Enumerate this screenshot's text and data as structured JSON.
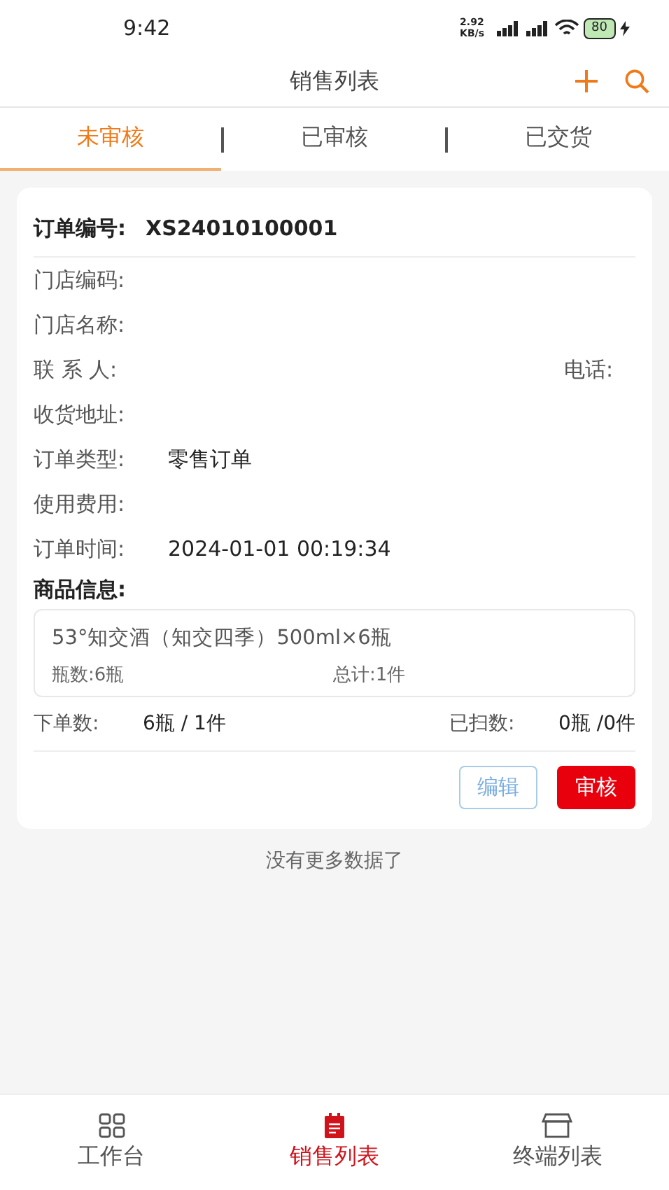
{
  "status_bar": {
    "time": "9:42",
    "speed": "2.92 KB/s",
    "battery": "80"
  },
  "header": {
    "title": "销售列表"
  },
  "tabs": [
    {
      "label": "未审核",
      "selected": true
    },
    {
      "label": "已审核",
      "selected": false
    },
    {
      "label": "已交货",
      "selected": false
    }
  ],
  "order": {
    "number_label": "订单编号:",
    "number": "XS24010100001",
    "fields": [
      {
        "label": "门店编码:"
      },
      {
        "label": "门店名称:"
      },
      {
        "label": "联 系 人:",
        "extra_label": "电话:"
      },
      {
        "label": "收货地址:"
      },
      {
        "label": "订单类型:",
        "value": "零售订单"
      },
      {
        "label": "使用费用:"
      },
      {
        "label": "订单时间:",
        "value": "2024-01-01 00:19:34"
      }
    ],
    "goods_label": "商品信息:",
    "goods": [
      {
        "name": "53°知交酒（知交四季）500ml×6瓶",
        "bottles": "瓶数:6瓶",
        "total": "总计:1件"
      }
    ],
    "ordered_label": "下单数:",
    "ordered": "6瓶 / 1件",
    "scanned_label": "已扫数:",
    "scanned": "0瓶 /0件",
    "buttons": [
      {
        "label": "编辑",
        "kind": "outline"
      },
      {
        "label": "审核",
        "kind": "primary"
      }
    ]
  },
  "footer_note": "没有更多数据了",
  "bottom_nav": [
    {
      "label": "工作台",
      "kind": "grid",
      "selected": false
    },
    {
      "label": "销售列表",
      "kind": "list",
      "selected": true
    },
    {
      "label": "终端列表",
      "kind": "store",
      "selected": false
    }
  ]
}
